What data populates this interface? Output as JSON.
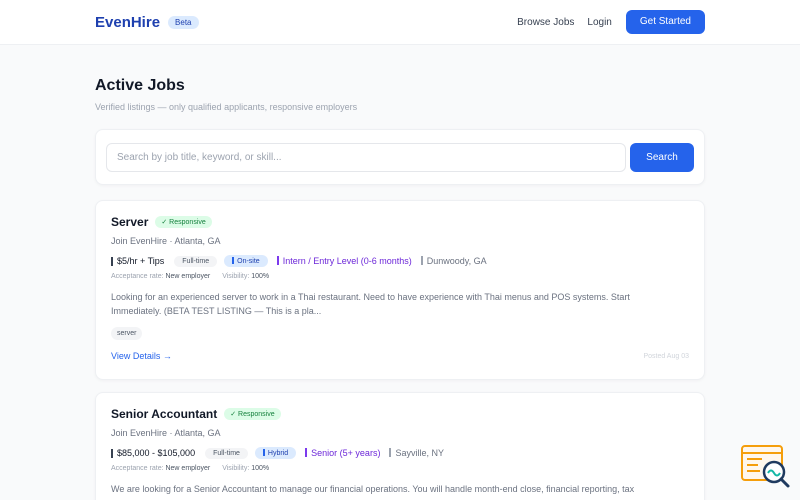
{
  "nav": {
    "logo": "EvenHire",
    "beta": "Beta",
    "links": [
      "Browse Jobs",
      "Login"
    ],
    "cta": "Get Started"
  },
  "page": {
    "title": "Active Jobs",
    "subtitle": "Verified listings — only qualified applicants, responsive employers"
  },
  "search": {
    "placeholder": "Search by job title, keyword, or skill...",
    "button": "Search"
  },
  "jobs": [
    {
      "title": "Server",
      "badge": "✓ Responsive",
      "company": "Join EvenHire · Atlanta, GA",
      "salary": "$5/hr + Tips",
      "type": "Full-time",
      "mode": "On-site",
      "level": "Intern / Entry Level (0-6 months)",
      "location": "Dunwoody, GA",
      "acceptance_label": "Acceptance rate:",
      "acceptance": "New employer",
      "visibility_label": "Visibility:",
      "visibility": "100%",
      "description": "Looking for an experienced server to work in a Thai restaurant. Need to have experience with Thai menus and POS systems. Start Immediately. (BETA TEST LISTING — This is a pla...",
      "tags": [
        "server"
      ],
      "link": "View Details →",
      "posted": "Posted Aug 03"
    },
    {
      "title": "Senior Accountant",
      "badge": "✓ Responsive",
      "company": "Join EvenHire · Atlanta, GA",
      "salary": "$85,000 - $105,000",
      "type": "Full-time",
      "mode": "Hybrid",
      "level": "Senior (5+ years)",
      "location": "Sayville, NY",
      "acceptance_label": "Acceptance rate:",
      "acceptance": "New employer",
      "visibility_label": "Visibility:",
      "visibility": "100%",
      "description": "We are looking for a Senior Accountant to manage our financial operations. You will handle month-end close, financial reporting, tax"
    }
  ],
  "icons": {
    "help": "help-search-icon"
  },
  "colors": {
    "primary": "#2563eb",
    "brand": "#1e40af",
    "responsive_bg": "#dcfce7",
    "responsive_text": "#15803d",
    "level_text": "#6d28d9",
    "help_accent": "#f59e0b"
  }
}
